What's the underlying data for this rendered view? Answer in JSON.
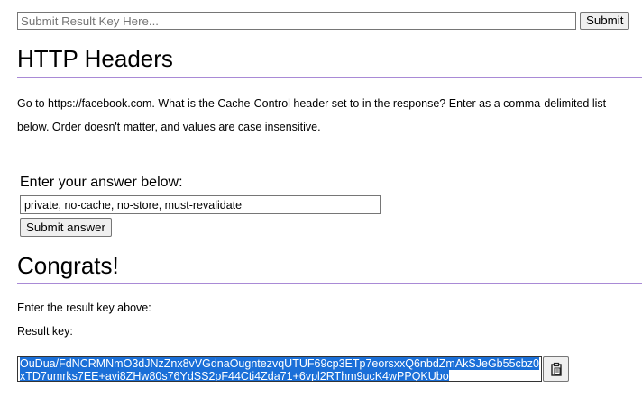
{
  "topbar": {
    "key_placeholder": "Submit Result Key Here...",
    "submit_label": "Submit"
  },
  "section1": {
    "title": "HTTP Headers",
    "question": "Go to https://facebook.com. What is the Cache-Control header set to in the response? Enter as a comma-delimited list below. Order doesn't matter, and values are case insensitive.",
    "answer_label": "Enter your answer below:",
    "answer_value": "private, no-cache, no-store, must-revalidate",
    "answer_button": "Submit answer"
  },
  "section2": {
    "title": "Congrats!",
    "instruction": "Enter the result key above:",
    "result_label": "Result key:",
    "result_key": "OuDua/FdNCRMNmO3dJNzZnx8vVGdnaOugntezvqUTUF69cp3ETp7eorsxxQ6nbdZmAkSJeGb55cbz0xTD7umrks7EE+avi8ZHw80s76YdSS2pF44Cti4Zda71+6vpl2RThm9ucK4wPPQKUbo"
  },
  "icons": {
    "copy": "clipboard-icon"
  },
  "colors": {
    "rule": "#a98ad6",
    "selection": "#1a6fd8"
  }
}
